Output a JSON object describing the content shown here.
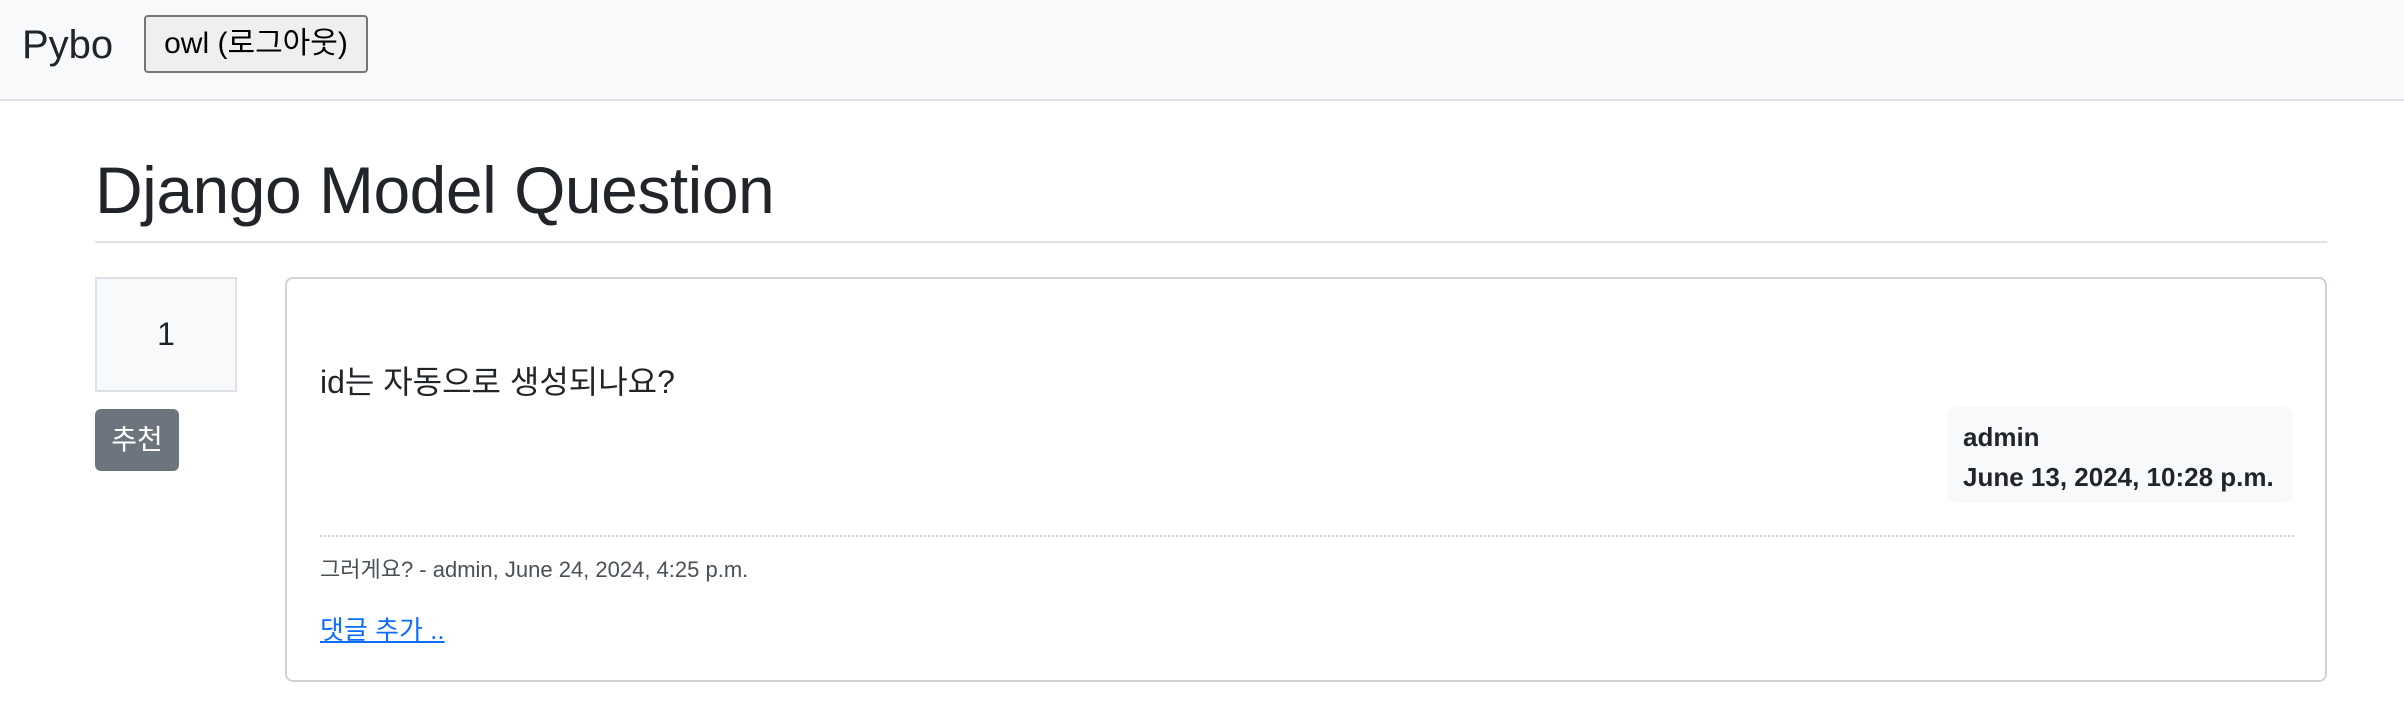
{
  "navbar": {
    "brand": "Pybo",
    "logout_label": "owl (로그아웃)"
  },
  "question": {
    "title": "Django Model Question",
    "content": "id는 자동으로 생성되나요?",
    "author": "admin",
    "created": "June 13, 2024, 10:28 p.m."
  },
  "vote": {
    "count": "1",
    "recommend_label": "추천"
  },
  "comments": [
    {
      "text": "그러게요? - admin, June 24, 2024, 4:25 p.m."
    }
  ],
  "add_comment_label": "댓글 추가 ..",
  "colors": {
    "navbar_bg": "#f8f9fa",
    "recommend_bg": "#6c757d",
    "link": "#0d6efd"
  }
}
